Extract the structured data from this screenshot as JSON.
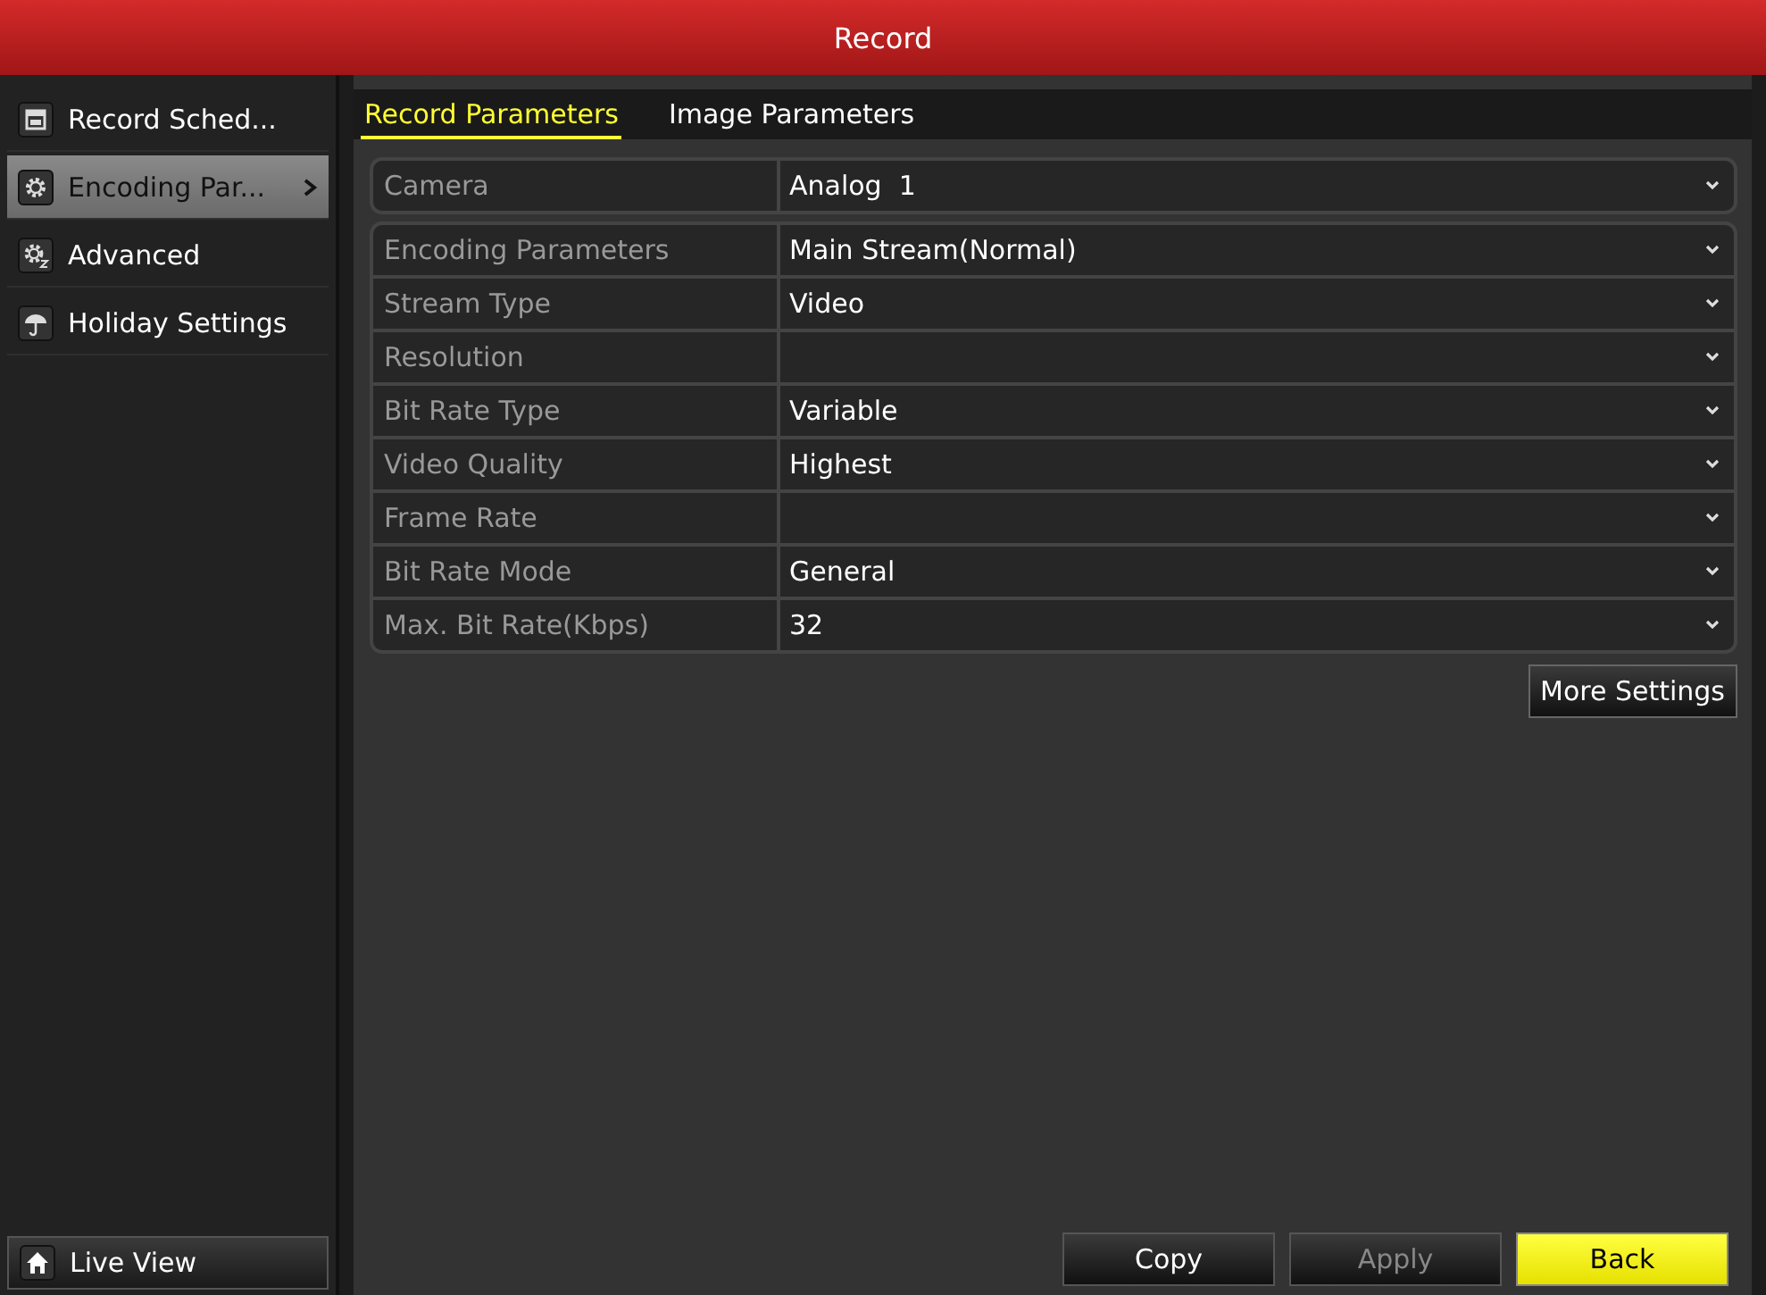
{
  "window": {
    "title": "Record"
  },
  "sidebar": {
    "items": [
      {
        "label": "Record Sched...",
        "selected": false
      },
      {
        "label": "Encoding Par...",
        "selected": true
      },
      {
        "label": "Advanced",
        "selected": false
      },
      {
        "label": "Holiday Settings",
        "selected": false
      }
    ],
    "bottom_button": {
      "label": "Live View"
    }
  },
  "tabs": [
    {
      "label": "Record Parameters",
      "selected": true
    },
    {
      "label": "Image Parameters",
      "selected": false
    }
  ],
  "camera": {
    "label": "Camera",
    "value": "Analog  1"
  },
  "fields": [
    {
      "label": "Encoding Parameters",
      "value": "Main Stream(Normal)"
    },
    {
      "label": "Stream Type",
      "value": "Video"
    },
    {
      "label": "Resolution"
    },
    {
      "label": "Bit Rate Type",
      "value": "Variable"
    },
    {
      "label": "Video Quality",
      "value": "Highest"
    },
    {
      "label": "Frame Rate"
    },
    {
      "label": "Bit Rate Mode",
      "value": "General"
    },
    {
      "label": "Max. Bit Rate(Kbps)",
      "value": "32"
    }
  ],
  "more_button": {
    "label": "More Settings"
  },
  "buttons": [
    {
      "label": "Copy",
      "kind": "normal",
      "disabled": false
    },
    {
      "label": "Apply",
      "kind": "normal",
      "disabled": true
    },
    {
      "label": "Back",
      "kind": "primary",
      "disabled": false
    }
  ]
}
